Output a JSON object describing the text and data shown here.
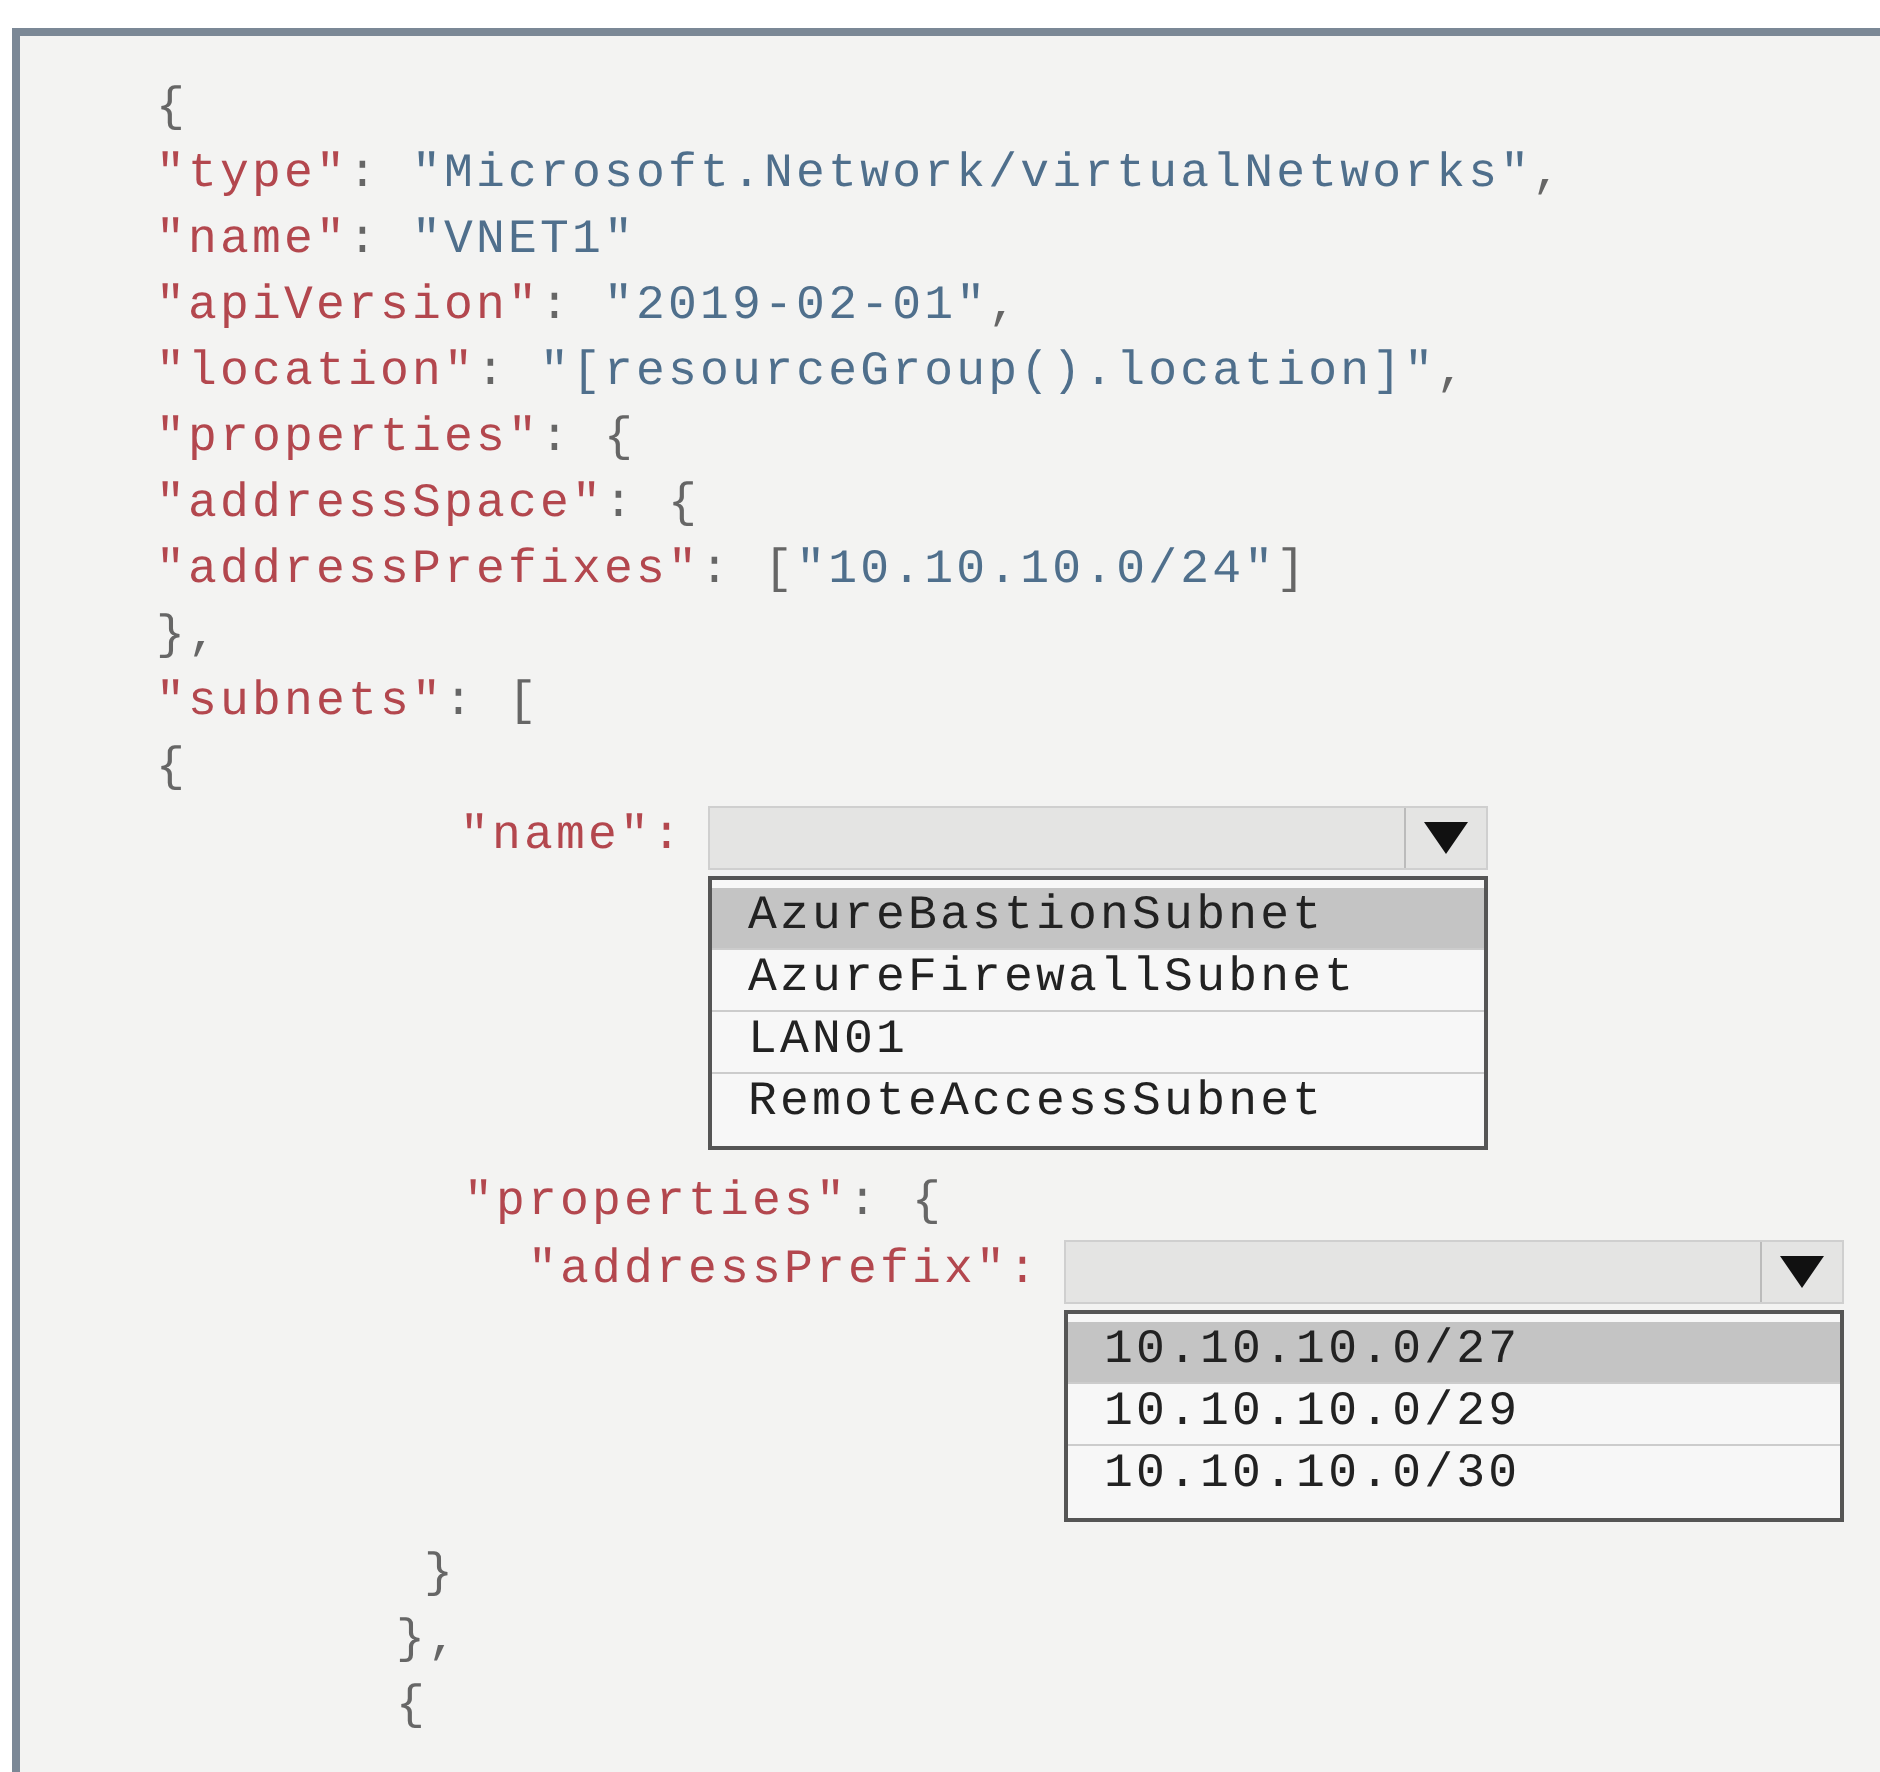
{
  "lines": [
    {
      "kind": "code",
      "segments": [
        {
          "kind": "punct",
          "text": "{"
        }
      ]
    },
    {
      "kind": "code",
      "segments": [
        {
          "kind": "key",
          "text": "\"type\""
        },
        {
          "kind": "punct",
          "text": ": "
        },
        {
          "kind": "string",
          "text": "\"Microsoft.Network/virtualNetworks\""
        },
        {
          "kind": "punct",
          "text": ","
        }
      ]
    },
    {
      "kind": "code",
      "segments": [
        {
          "kind": "key",
          "text": "\"name\""
        },
        {
          "kind": "punct",
          "text": ": "
        },
        {
          "kind": "string",
          "text": "\"VNET1\""
        }
      ]
    },
    {
      "kind": "code",
      "segments": [
        {
          "kind": "key",
          "text": "\"apiVersion\""
        },
        {
          "kind": "punct",
          "text": ": "
        },
        {
          "kind": "string",
          "text": "\"2019-02-01\""
        },
        {
          "kind": "punct",
          "text": ","
        }
      ]
    },
    {
      "kind": "code",
      "segments": [
        {
          "kind": "key",
          "text": "\"location\""
        },
        {
          "kind": "punct",
          "text": ": "
        },
        {
          "kind": "string",
          "text": "\"[resourceGroup().location]\""
        },
        {
          "kind": "punct",
          "text": ","
        }
      ]
    },
    {
      "kind": "code",
      "segments": [
        {
          "kind": "key",
          "text": "\"properties\""
        },
        {
          "kind": "punct",
          "text": ": {"
        }
      ]
    },
    {
      "kind": "code",
      "segments": [
        {
          "kind": "key",
          "text": "\"addressSpace\""
        },
        {
          "kind": "punct",
          "text": ": {"
        }
      ]
    },
    {
      "kind": "code",
      "segments": [
        {
          "kind": "key",
          "text": "\"addressPrefixes\""
        },
        {
          "kind": "punct",
          "text": ": ["
        },
        {
          "kind": "string",
          "text": "\"10.10.10.0/24\""
        },
        {
          "kind": "punct",
          "text": "]"
        }
      ]
    },
    {
      "kind": "code",
      "segments": [
        {
          "kind": "punct",
          "text": "},"
        }
      ]
    },
    {
      "kind": "code",
      "segments": [
        {
          "kind": "key",
          "text": "\"subnets\""
        },
        {
          "kind": "punct",
          "text": ": ["
        }
      ]
    },
    {
      "kind": "code",
      "segments": [
        {
          "kind": "punct",
          "text": "{"
        }
      ]
    },
    {
      "kind": "dropdown-inner",
      "key": "\"name\":",
      "options": [
        {
          "label": "AzureBastionSubnet",
          "selected": true
        },
        {
          "label": "AzureFirewallSubnet",
          "selected": false
        },
        {
          "label": "LAN01",
          "selected": false
        },
        {
          "label": "RemoteAccessSubnet",
          "selected": false
        }
      ]
    },
    {
      "kind": "code-inner",
      "segments": [
        {
          "kind": "key",
          "text": "\"properties\""
        },
        {
          "kind": "punct",
          "text": ": {"
        }
      ]
    },
    {
      "kind": "dropdown-deep",
      "key": "\"addressPrefix\":",
      "options": [
        {
          "label": "10.10.10.0/27",
          "selected": true
        },
        {
          "label": "10.10.10.0/29",
          "selected": false
        },
        {
          "label": "10.10.10.0/30",
          "selected": false
        }
      ]
    },
    {
      "kind": "brace-inner",
      "segments": [
        {
          "kind": "punct",
          "text": "}"
        }
      ]
    },
    {
      "kind": "brace-outer",
      "segments": [
        {
          "kind": "punct",
          "text": "},"
        }
      ]
    },
    {
      "kind": "brace-outer",
      "segments": [
        {
          "kind": "punct",
          "text": "{"
        }
      ]
    }
  ]
}
